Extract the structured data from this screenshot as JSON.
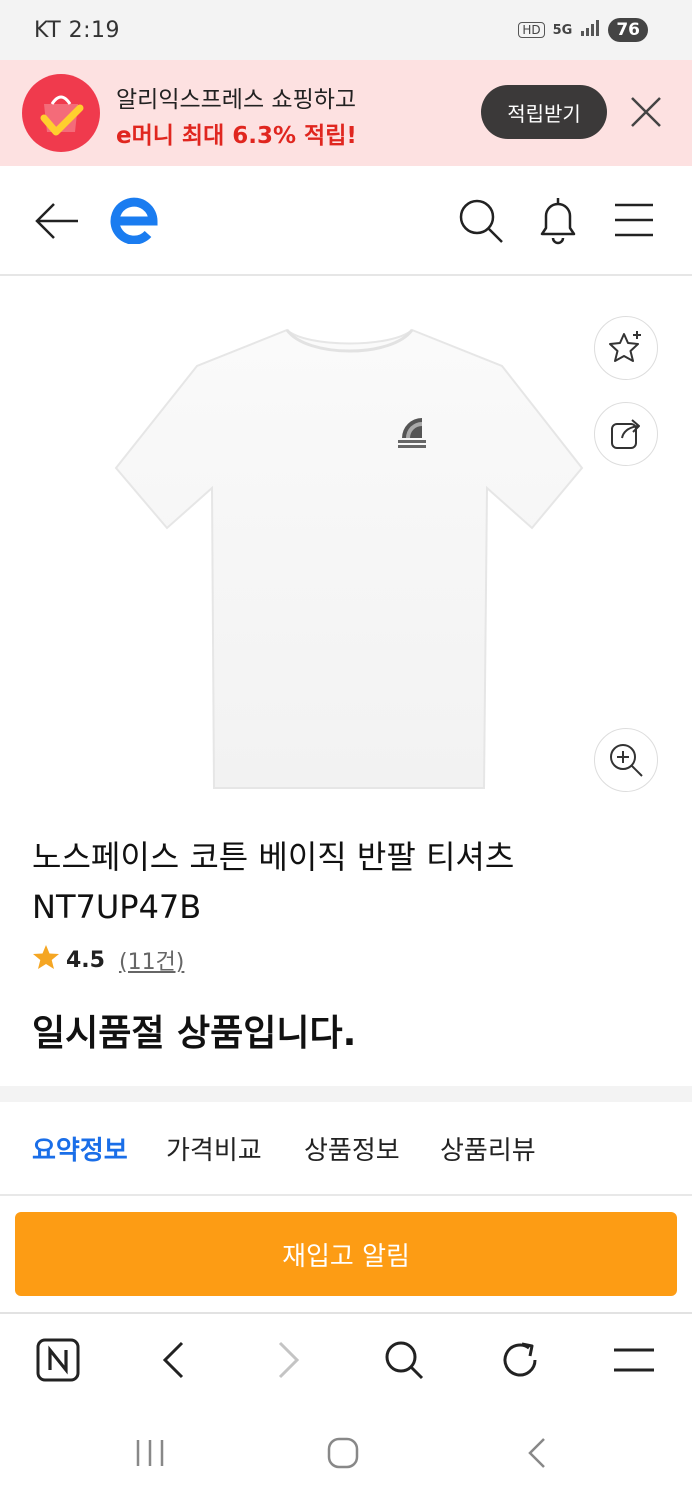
{
  "status_bar": {
    "carrier_time": "KT 2:19",
    "hd": "HD",
    "network": "5G",
    "battery": "76"
  },
  "promo": {
    "line1": "알리익스프레스 쇼핑하고",
    "line2": "e머니 최대 6.3% 적립!",
    "button": "적립받기"
  },
  "header": {
    "logo_letter": "e"
  },
  "product": {
    "title": "노스페이스 코튼 베이직 반팔 티셔츠 NT7UP47B",
    "rating": "4.5",
    "review_count": "(11건)",
    "status": "일시품절 상품입니다."
  },
  "tabs": [
    {
      "label": "요약정보",
      "active": true
    },
    {
      "label": "가격비교"
    },
    {
      "label": "상품정보"
    },
    {
      "label": "상품리뷰"
    }
  ],
  "cta": {
    "label": "재입고 알림"
  },
  "colors": {
    "accent_blue": "#1a6ee8",
    "cta_orange": "#fd9c14",
    "promo_bg": "#fde1e1",
    "promo_red": "#e0261f"
  }
}
